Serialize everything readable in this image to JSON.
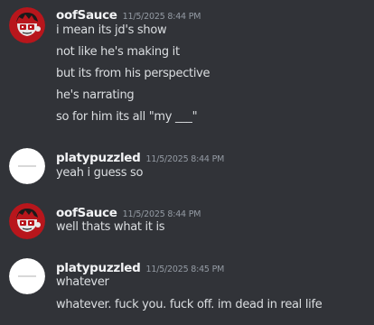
{
  "messages": [
    {
      "author": "oofSauce",
      "timestamp": "11/5/2025 8:44 PM",
      "avatar_icon": "red-cartoon-character-avatar",
      "lines": [
        "i mean its jd's show",
        "not like he's making it",
        "but its from his perspective",
        "he's narrating",
        "so for him its all \"my ___\""
      ]
    },
    {
      "author": "platypuzzled",
      "timestamp": "11/5/2025 8:44 PM",
      "avatar_icon": "white-circle-avatar",
      "lines": [
        "yeah i guess so"
      ]
    },
    {
      "author": "oofSauce",
      "timestamp": "11/5/2025 8:44 PM",
      "avatar_icon": "red-cartoon-character-avatar",
      "lines": [
        "well thats what it is"
      ]
    },
    {
      "author": "platypuzzled",
      "timestamp": "11/5/2025 8:45 PM",
      "avatar_icon": "white-circle-avatar",
      "lines": [
        "whatever",
        "whatever. fuck you. fuck off. im dead in real life"
      ]
    }
  ],
  "colors": {
    "background": "#313338",
    "username": "#f2f3f5",
    "timestamp": "#949ba4",
    "message_text": "#dbdee1",
    "avatar_red": "#b8161c"
  }
}
